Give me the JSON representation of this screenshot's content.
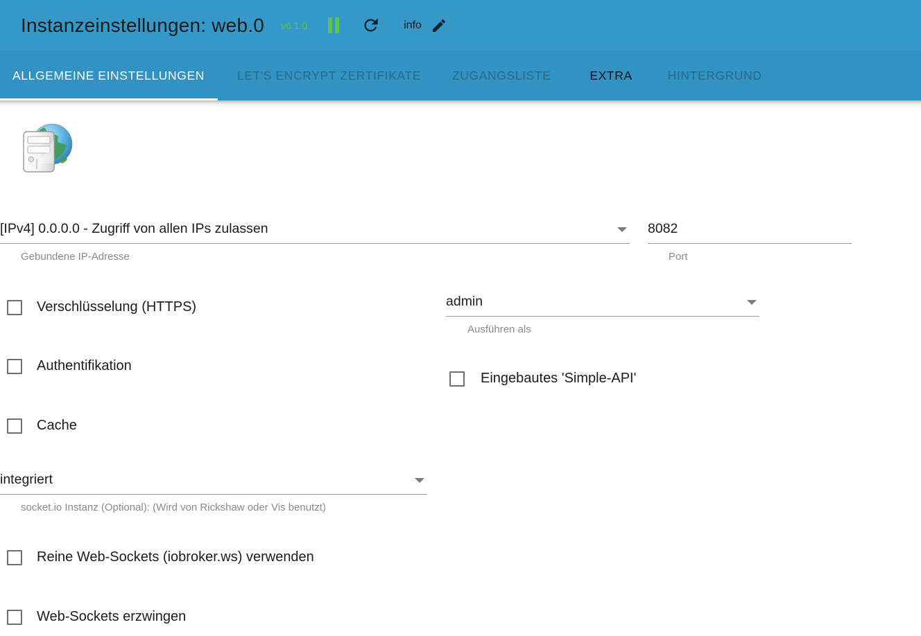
{
  "header": {
    "title": "Instanzeinstellungen: web.0",
    "version": "v6.1.0",
    "version_color": "#5fc24e",
    "accent_color": "#3498c8",
    "tabbar_color": "#3093c4",
    "info_label": "info",
    "icons": {
      "pause": "pause-icon",
      "refresh": "refresh-icon",
      "edit": "pencil-icon"
    }
  },
  "tabs": [
    {
      "label": "ALLGEMEINE EINSTELLUNGEN",
      "state": "active"
    },
    {
      "label": "LET'S ENCRYPT ZERTIFIKATE",
      "state": "inactive"
    },
    {
      "label": "ZUGANGSLISTE",
      "state": "inactive"
    },
    {
      "label": "EXTRA",
      "state": "current"
    },
    {
      "label": "HINTERGRUND",
      "state": "inactive"
    }
  ],
  "main": {
    "adapter_icon": "server-globe-icon",
    "fields": {
      "bound_ip": {
        "value": "[IPv4] 0.0.0.0 - Zugriff von allen IPs zulassen",
        "helper": "Gebundene IP-Adresse",
        "type": "select"
      },
      "port": {
        "value": "8082",
        "helper": "Port",
        "type": "text"
      },
      "run_as": {
        "value": "admin",
        "helper": "Ausführen als",
        "type": "select"
      },
      "socketio": {
        "value": "integriert",
        "helper": "socket.io Instanz (Optional): (Wird von Rickshaw oder Vis benutzt)",
        "type": "select"
      }
    },
    "checkboxes": [
      {
        "name": "https",
        "label": "Verschlüsselung (HTTPS)",
        "checked": false
      },
      {
        "name": "auth",
        "label": "Authentifikation",
        "checked": false
      },
      {
        "name": "cache",
        "label": "Cache",
        "checked": false
      },
      {
        "name": "simple_api",
        "label": "Eingebautes 'Simple-API'",
        "checked": false
      },
      {
        "name": "pure_ws",
        "label": "Reine Web-Sockets (iobroker.ws) verwenden",
        "checked": false
      },
      {
        "name": "force_ws",
        "label": "Web-Sockets erzwingen",
        "checked": false
      }
    ]
  }
}
